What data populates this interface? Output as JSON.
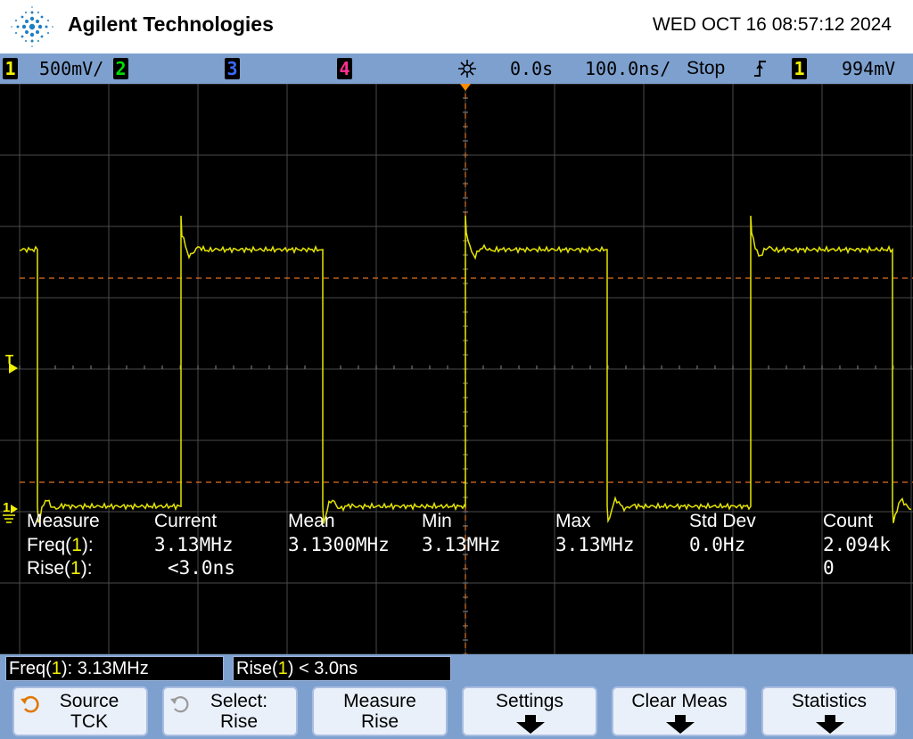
{
  "header": {
    "brand": "Agilent Technologies",
    "datetime": "WED OCT 16 08:57:12 2024"
  },
  "status_bar": {
    "ch1_label": "1",
    "ch1_scale": "500mV/",
    "ch2_label": "2",
    "ch3_label": "3",
    "ch4_label": "4",
    "trigger_delay": "0.0s",
    "timebase": "100.0ns/",
    "run_state": "Stop",
    "trigger_source": "1",
    "trigger_level": "994mV"
  },
  "markers": {
    "trigger_level_marker": "T",
    "ground_marker": "1"
  },
  "measurements": {
    "headers": [
      "Measure",
      "Current",
      "Mean",
      "Min",
      "Max",
      "Std Dev",
      "Count"
    ],
    "rows": [
      {
        "name": "Freq(",
        "channel": "1",
        "suffix": "):",
        "values": [
          "3.13MHz",
          "3.1300MHz",
          "3.13MHz",
          "3.13MHz",
          "0.0Hz",
          "2.094k"
        ]
      },
      {
        "name": "Rise(",
        "channel": "1",
        "suffix": "):",
        "values": [
          "<3.0ns",
          "",
          "",
          "",
          "",
          "0"
        ]
      }
    ]
  },
  "readouts": [
    {
      "prefix": "Freq(",
      "channel": "1",
      "suffix": "): 3.13MHz"
    },
    {
      "prefix": "Rise(",
      "channel": "1",
      "suffix": ") < 3.0ns"
    }
  ],
  "softkeys": [
    {
      "line1": "Source",
      "line2": "TCK"
    },
    {
      "line1": "Select:",
      "line2": "Rise"
    },
    {
      "line1": "Measure",
      "line2": "Rise"
    },
    {
      "line1": "Settings",
      "line2": ""
    },
    {
      "line1": "Clear Meas",
      "line2": ""
    },
    {
      "line1": "Statistics",
      "line2": ""
    }
  ],
  "colors": {
    "channel1": "#f2f200",
    "channel2": "#00e000",
    "channel3": "#3a6cff",
    "channel4": "#ff2f8f",
    "trigger_marker": "#ff8c00",
    "bar": "#7da0cf"
  },
  "icons": [
    "agilent-logo-icon",
    "trigger-icon",
    "rising-edge-icon",
    "entry-knob-icon",
    "down-arrow-icon"
  ]
}
